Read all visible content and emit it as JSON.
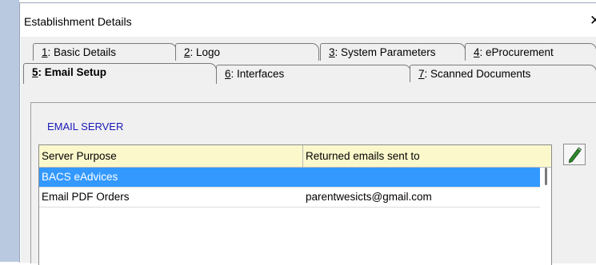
{
  "window": {
    "title": "Establishment Details",
    "close_glyph": "✕"
  },
  "tabs_row1": [
    {
      "key": "1",
      "label": ": Basic Details"
    },
    {
      "key": "2",
      "label": ": Logo"
    },
    {
      "key": "3",
      "label": ": System Parameters"
    },
    {
      "key": "4",
      "label": ": eProcurement"
    }
  ],
  "tabs_row2": [
    {
      "key": "5",
      "label": ": Email Setup",
      "active": true
    },
    {
      "key": "6",
      "label": ": Interfaces"
    },
    {
      "key": "7",
      "label": ": Scanned Documents"
    }
  ],
  "section": {
    "label": "EMAIL SERVER"
  },
  "grid": {
    "columns": [
      "Server Purpose",
      "Returned emails sent to"
    ],
    "rows": [
      {
        "purpose": "BACS eAdvices",
        "returned_to": "",
        "selected": true
      },
      {
        "purpose": "Email PDF Orders",
        "returned_to": "parentwesicts@gmail.com",
        "selected": false
      }
    ]
  },
  "toolbar": {
    "edit_icon": "pencil-icon"
  },
  "colors": {
    "accent": "#1a1ab8",
    "selection": "#3399ff",
    "header_bg": "#fbf9cc",
    "pencil": "#2e8b2e"
  }
}
